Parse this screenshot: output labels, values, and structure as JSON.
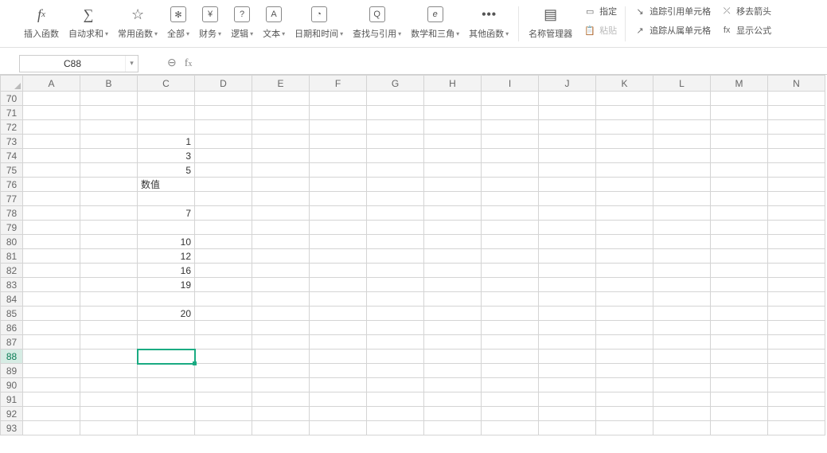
{
  "ribbon": {
    "insert_fn": "插入函数",
    "auto_sum": "自动求和",
    "common_fn": "常用函数",
    "all": "全部",
    "finance": "财务",
    "logic": "逻辑",
    "text": "文本",
    "datetime": "日期和时间",
    "lookup": "查找与引用",
    "math_trig": "数学和三角",
    "other_fn": "其他函数",
    "name_mgr": "名称管理器",
    "assign": "指定",
    "paste": "粘贴",
    "trace_precedents": "追踪引用单元格",
    "trace_dependents": "追踪从属单元格",
    "remove_arrows": "移去箭头",
    "show_formula": "显示公式"
  },
  "namebox": {
    "value": "C88"
  },
  "formula": {
    "value": ""
  },
  "columns": [
    "A",
    "B",
    "C",
    "D",
    "E",
    "F",
    "G",
    "H",
    "I",
    "J",
    "K",
    "L",
    "M",
    "N"
  ],
  "row_start": 70,
  "row_end": 93,
  "selected": {
    "row": 88,
    "col": "C"
  },
  "cells": {
    "C73": "1",
    "C74": "3",
    "C75": "5",
    "C76": "数值",
    "C78": "7",
    "C80": "10",
    "C81": "12",
    "C82": "16",
    "C83": "19",
    "C85": "20"
  },
  "text_cells": [
    "C76"
  ]
}
